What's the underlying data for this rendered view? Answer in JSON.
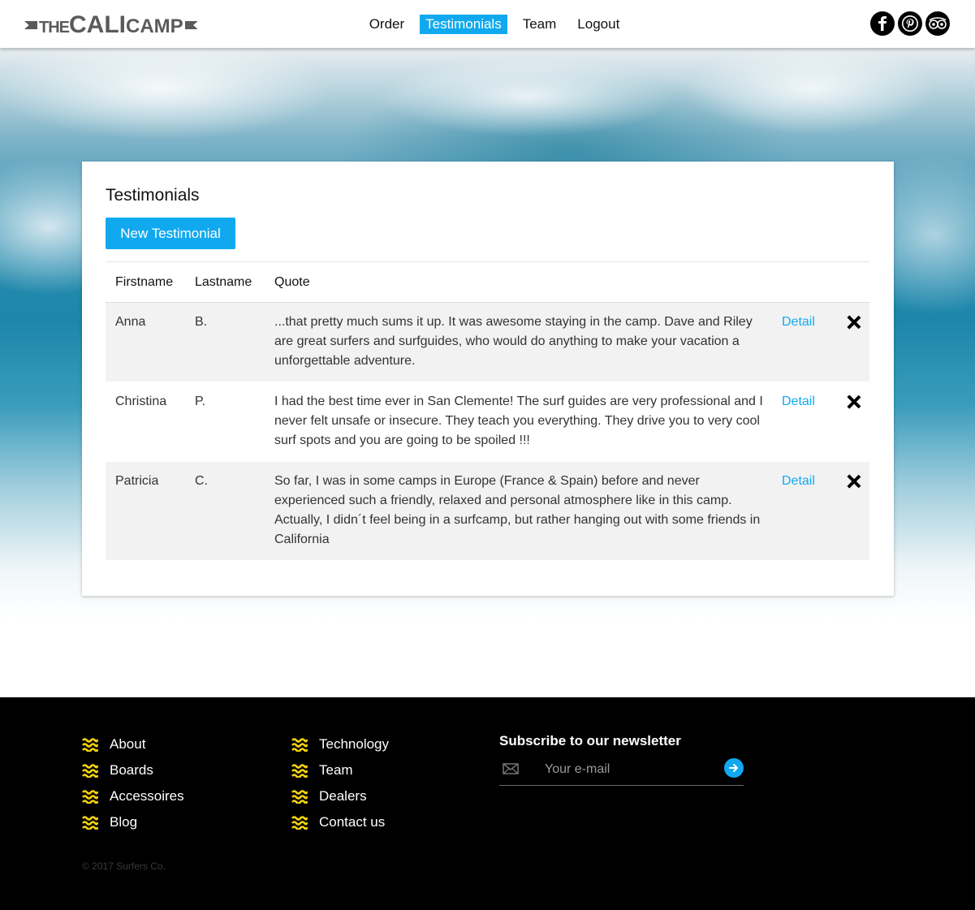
{
  "header": {
    "logo": {
      "the": "THE",
      "cali": "CALI",
      "camp": "CAMP"
    },
    "nav": [
      {
        "label": "Order",
        "active": false
      },
      {
        "label": "Testimonials",
        "active": true
      },
      {
        "label": "Team",
        "active": false
      },
      {
        "label": "Logout",
        "active": false
      }
    ],
    "social": [
      "facebook-icon",
      "pinterest-icon",
      "tripadvisor-icon"
    ]
  },
  "main": {
    "title": "Testimonials",
    "new_button": "New Testimonial",
    "table": {
      "headers": [
        "Firstname",
        "Lastname",
        "Quote"
      ],
      "rows": [
        {
          "firstname": "Anna",
          "lastname": "B.",
          "quote": "...that pretty much sums it up. It was awesome staying in the camp. Dave and Riley are great surfers and surfguides, who would do anything to make your vacation a unforgettable adventure.",
          "detail": "Detail"
        },
        {
          "firstname": "Christina",
          "lastname": "P.",
          "quote": "I had the best time ever in San Clemente! The surf guides are very professional and I never felt unsafe or insecure. They teach you everything. They drive you to very cool surf spots and you are going to be spoiled !!!",
          "detail": "Detail"
        },
        {
          "firstname": "Patricia",
          "lastname": "C.",
          "quote": "So far, I was in some camps in Europe (France & Spain) before and never experienced such a friendly, relaxed and personal atmosphere like in this camp. Actually, I didn´t feel being in a surfcamp, but rather hanging out with some friends in California",
          "detail": "Detail"
        }
      ]
    }
  },
  "footer": {
    "col1": [
      "About",
      "Boards",
      "Accessoires",
      "Blog"
    ],
    "col2": [
      "Technology",
      "Team",
      "Dealers",
      "Contact us"
    ],
    "newsletter": {
      "title": "Subscribe to our newsletter",
      "placeholder": "Your e-mail"
    },
    "copyright": "© 2017 Surfers Co."
  },
  "colors": {
    "accent": "#10a9ef",
    "wave_icon": "#f5d30f",
    "footer_bg": "#000000"
  }
}
